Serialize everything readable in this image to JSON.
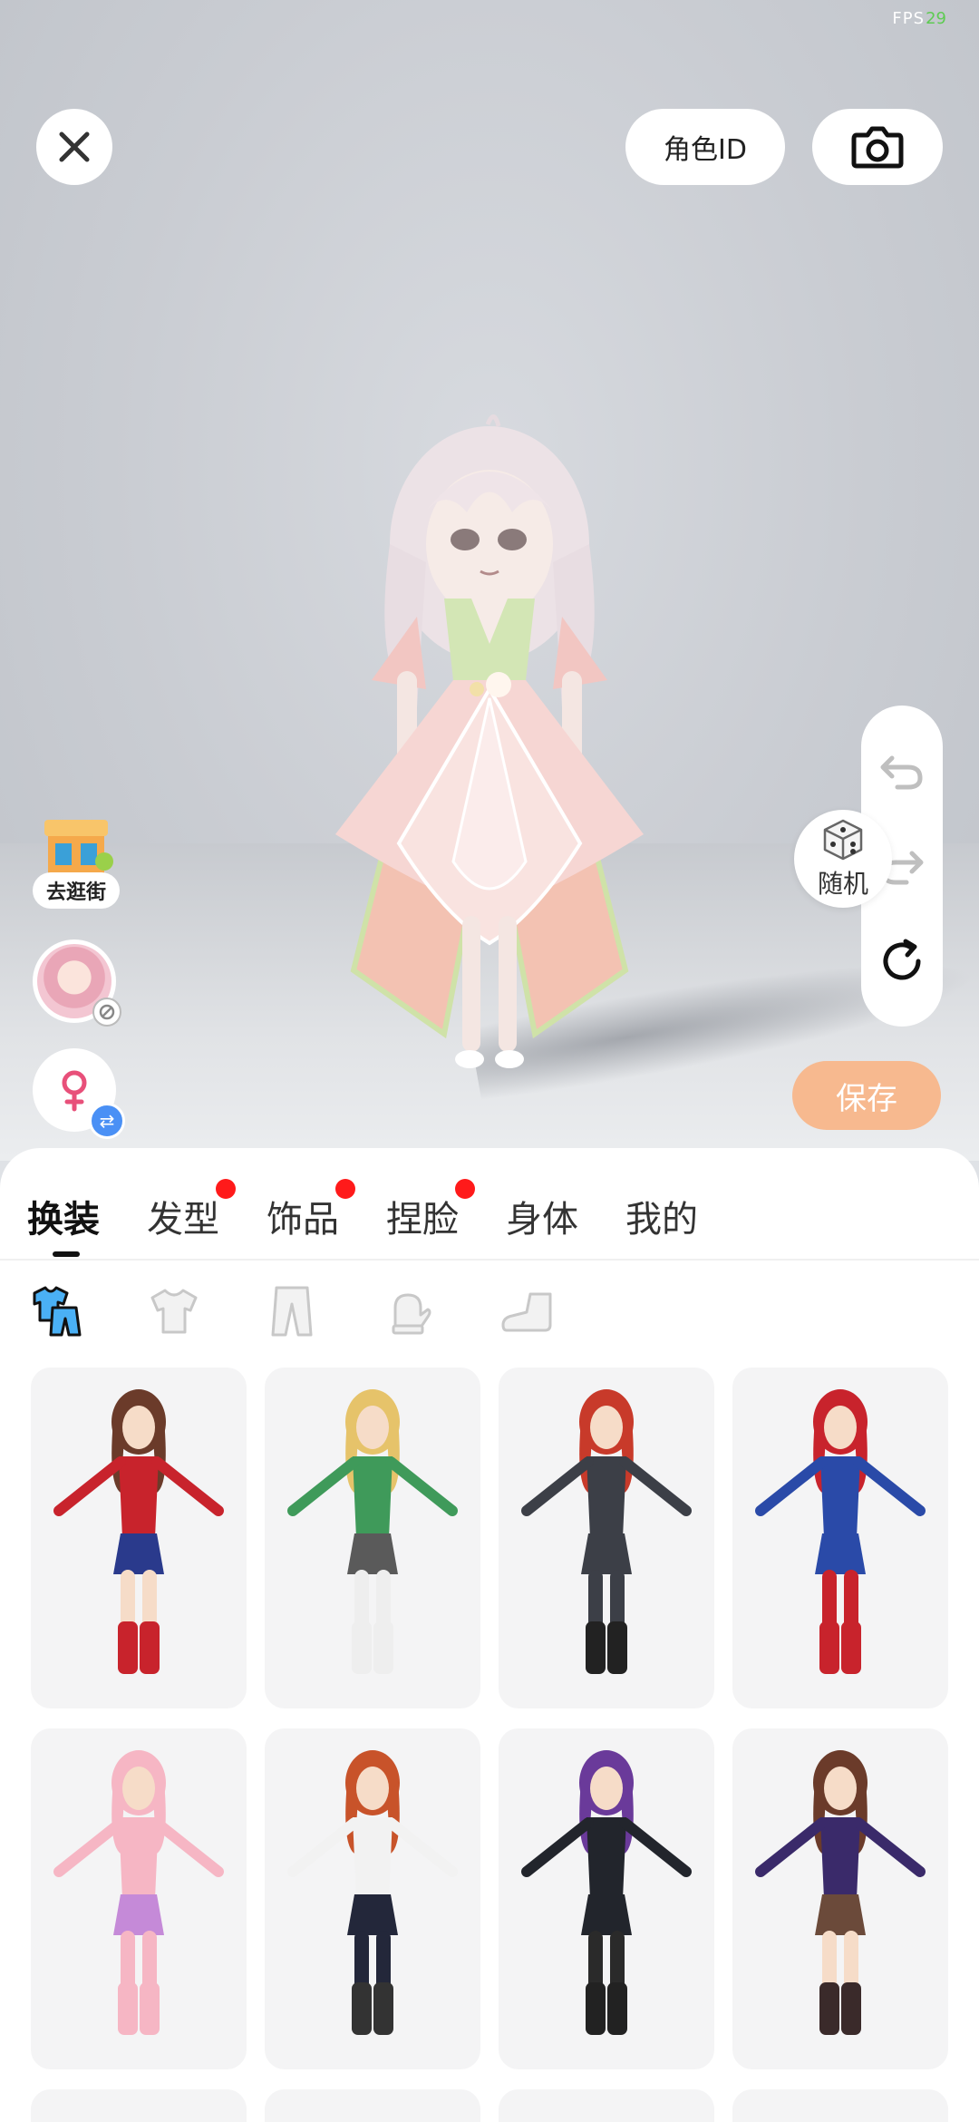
{
  "status": {
    "fps_label": "FPS",
    "fps_value": "29"
  },
  "header": {
    "role_id_label": "角色ID"
  },
  "left_actions": {
    "shop_label": "去逛街"
  },
  "actions": {
    "save_label": "保存"
  },
  "tabs": [
    {
      "label": "换装",
      "active": true,
      "dot": false
    },
    {
      "label": "发型",
      "active": false,
      "dot": true
    },
    {
      "label": "饰品",
      "active": false,
      "dot": true
    },
    {
      "label": "捏脸",
      "active": false,
      "dot": true
    },
    {
      "label": "身体",
      "active": false,
      "dot": false
    },
    {
      "label": "我的",
      "active": false,
      "dot": false
    }
  ],
  "subtabs": [
    "outfit-set-icon",
    "top-icon",
    "pants-icon",
    "glove-icon",
    "shoe-icon"
  ],
  "outfits": [
    {
      "name": "outfit-wonder",
      "hair": "#6b3b2a",
      "top": "#c8232c",
      "bottom": "#2a3a8c",
      "legs": "#f6dcc8",
      "boots": "#c8232c"
    },
    {
      "name": "outfit-green-kimono",
      "hair": "#e6c36a",
      "top": "#3f9a5a",
      "bottom": "#5a5a5a",
      "legs": "#eeeeee",
      "boots": "#eeeeee"
    },
    {
      "name": "outfit-black-suit",
      "hair": "#c83a2a",
      "top": "#3c3f47",
      "bottom": "#3c3f47",
      "legs": "#3c3f47",
      "boots": "#222222"
    },
    {
      "name": "outfit-captain",
      "hair": "#c8232c",
      "top": "#2a4aa8",
      "bottom": "#2a4aa8",
      "legs": "#c8232c",
      "boots": "#c8232c"
    },
    {
      "name": "outfit-pink-cat",
      "hair": "#f6b6c4",
      "top": "#f6b6c4",
      "bottom": "#c58ad8",
      "legs": "#f6b6c4",
      "boots": "#f6b6c4"
    },
    {
      "name": "outfit-sport",
      "hair": "#c8532a",
      "top": "#f2f2f2",
      "bottom": "#23273a",
      "legs": "#23273a",
      "boots": "#333333"
    },
    {
      "name": "outfit-gothic",
      "hair": "#6a3a9a",
      "top": "#22252c",
      "bottom": "#22252c",
      "legs": "#2a2a2a",
      "boots": "#222222"
    },
    {
      "name": "outfit-wizard",
      "hair": "#6b3b2a",
      "top": "#3a2a6a",
      "bottom": "#6b4a3a",
      "legs": "#f6dcc8",
      "boots": "#3a2a2a"
    }
  ],
  "random_label": "随机"
}
